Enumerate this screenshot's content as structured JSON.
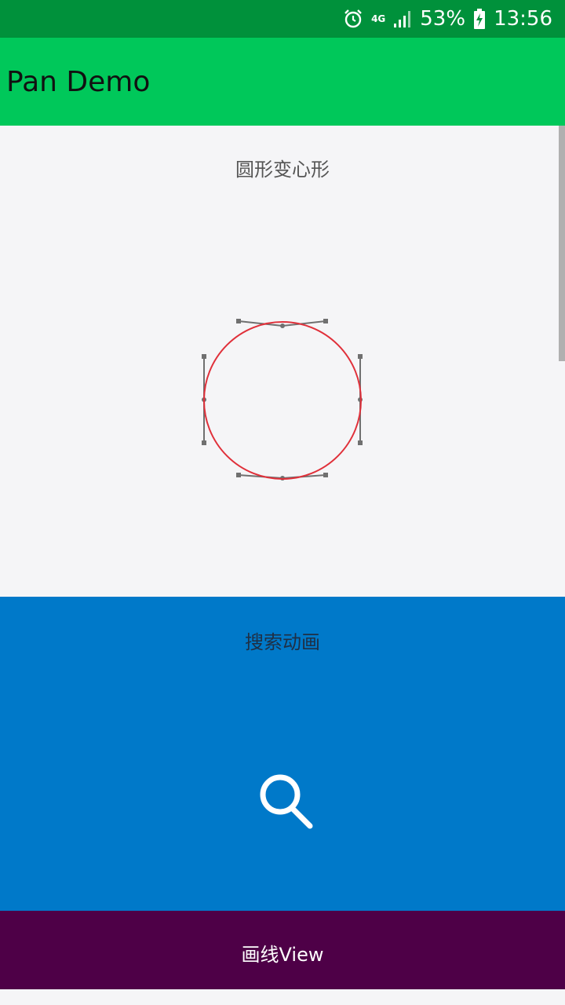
{
  "status_bar": {
    "network_type": "4G",
    "battery_percent": "53%",
    "time": "13:56",
    "icons": [
      "alarm-icon",
      "signal-icon",
      "battery-charging-icon"
    ]
  },
  "app_bar": {
    "title": "Pan Demo"
  },
  "cards": [
    {
      "title": "圆形变心形",
      "background": "#f5f5f7"
    },
    {
      "title": "搜索动画",
      "background": "#0079c9"
    },
    {
      "title": "画线View",
      "background": "#4e0047"
    }
  ],
  "colors": {
    "status_bar": "#00913b",
    "app_bar": "#00c85a",
    "circle_stroke": "#e0303a",
    "control_lines": "#707070"
  }
}
